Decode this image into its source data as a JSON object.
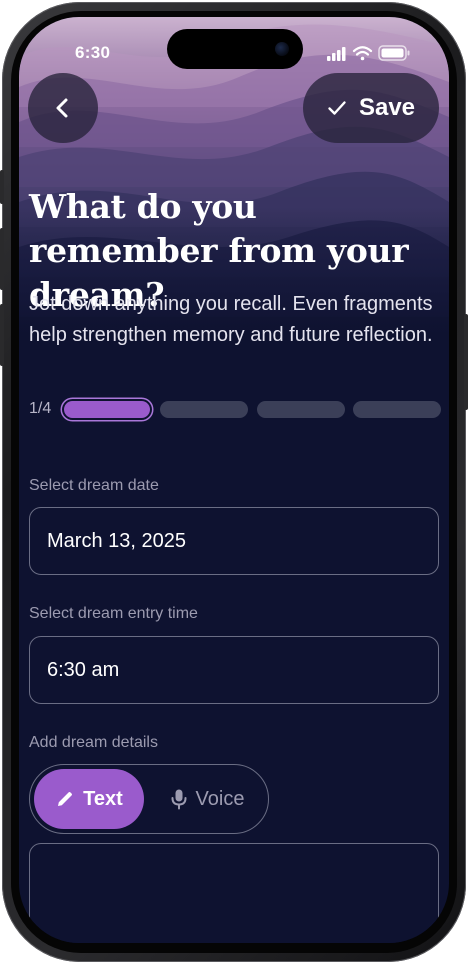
{
  "status_bar": {
    "time": "6:30",
    "icons": [
      "signal-icon",
      "wifi-icon",
      "battery-icon"
    ]
  },
  "header": {
    "back_icon": "chevron-left-icon",
    "save_icon": "checkmark-icon",
    "save_label": "Save"
  },
  "intro": {
    "title": "What do you remember from your dream?",
    "subtitle": "Jot down anything you recall. Even fragments help strengthen memory and future reflection."
  },
  "progress": {
    "label": "1/4",
    "current_step": 1,
    "total_steps": 4
  },
  "form": {
    "date": {
      "label": "Select dream date",
      "value": "March 13, 2025"
    },
    "time": {
      "label": "Select dream entry time",
      "value": "6:30 am"
    },
    "details": {
      "label": "Add dream details",
      "modes": [
        {
          "label": "Text",
          "icon": "pencil-icon",
          "selected": true
        },
        {
          "label": "Voice",
          "icon": "microphone-icon",
          "selected": false
        }
      ],
      "value": ""
    }
  },
  "colors": {
    "background": "#0e1230",
    "accent": "#9a5bcc",
    "field_border": "#6a6d84",
    "muted_text": "#9c9bb0",
    "inactive_segment": "#3b3f58"
  }
}
